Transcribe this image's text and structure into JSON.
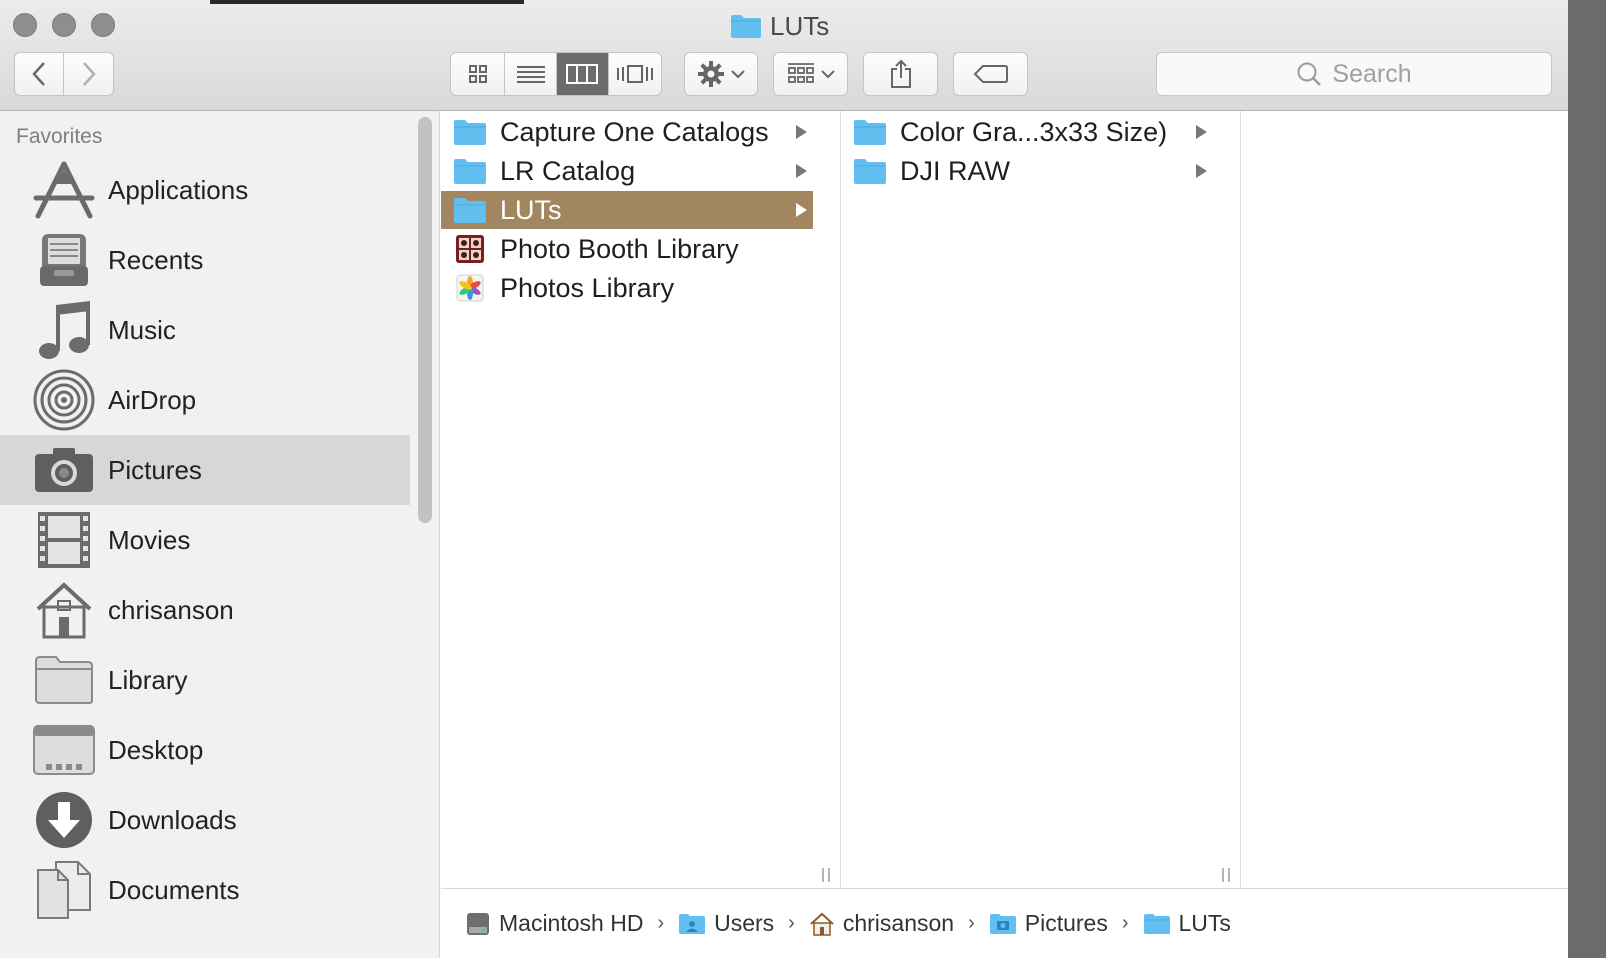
{
  "window": {
    "title": "LUTs"
  },
  "toolbar": {
    "back_icon": "chevron-left-icon",
    "forward_icon": "chevron-right-icon",
    "view_modes": [
      "icon-view",
      "list-view",
      "column-view",
      "cover-flow-view"
    ],
    "active_view": "column-view",
    "action_icon": "gear-icon",
    "arrange_icon": "arrange-grid-icon",
    "share_icon": "share-icon",
    "tags_icon": "tag-icon",
    "search_placeholder": "Search"
  },
  "sidebar": {
    "header": "Favorites",
    "items": [
      {
        "label": "Applications",
        "icon": "applications-icon"
      },
      {
        "label": "Recents",
        "icon": "recents-icon"
      },
      {
        "label": "Music",
        "icon": "music-icon"
      },
      {
        "label": "AirDrop",
        "icon": "airdrop-icon"
      },
      {
        "label": "Pictures",
        "icon": "camera-icon",
        "selected": true
      },
      {
        "label": "Movies",
        "icon": "film-icon"
      },
      {
        "label": "chrisanson",
        "icon": "home-icon"
      },
      {
        "label": "Library",
        "icon": "folder-icon"
      },
      {
        "label": "Desktop",
        "icon": "desktop-icon"
      },
      {
        "label": "Downloads",
        "icon": "downloads-icon"
      },
      {
        "label": "Documents",
        "icon": "documents-icon"
      }
    ]
  },
  "columns": {
    "col1": [
      {
        "label": "Capture One Catalogs",
        "icon": "folder-icon",
        "has_children": true
      },
      {
        "label": "LR Catalog",
        "icon": "folder-icon",
        "has_children": true
      },
      {
        "label": "LUTs",
        "icon": "folder-icon",
        "has_children": true,
        "selected": true
      },
      {
        "label": "Photo Booth Library",
        "icon": "photo-booth-icon",
        "has_children": false
      },
      {
        "label": "Photos Library",
        "icon": "photos-icon",
        "has_children": false
      }
    ],
    "col2": [
      {
        "label": "Color Gra...3x33 Size)",
        "icon": "folder-icon",
        "has_children": true
      },
      {
        "label": "DJI RAW",
        "icon": "folder-icon",
        "has_children": true
      }
    ]
  },
  "pathbar": [
    {
      "label": "Macintosh HD",
      "icon": "hard-drive-icon"
    },
    {
      "label": "Users",
      "icon": "users-folder-icon"
    },
    {
      "label": "chrisanson",
      "icon": "home-icon"
    },
    {
      "label": "Pictures",
      "icon": "pictures-folder-icon"
    },
    {
      "label": "LUTs",
      "icon": "folder-icon"
    }
  ],
  "colors": {
    "selection": "#a2865f",
    "folder": "#62c0f0",
    "sidebar_selection": "#d7d7d7"
  }
}
